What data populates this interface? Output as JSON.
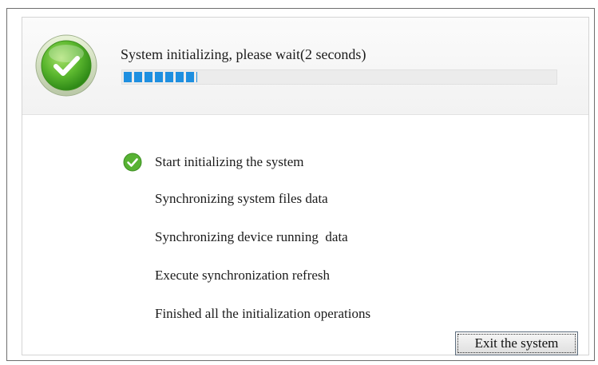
{
  "header": {
    "status_text": "System initializing, please wait(2 seconds)",
    "progress_percent": 17,
    "logo_icon": "green-check-orb-icon"
  },
  "steps": [
    {
      "label": "Start initializing the system",
      "done": true
    },
    {
      "label": "Synchronizing system files data",
      "done": false
    },
    {
      "label": "Synchronizing device running  data",
      "done": false
    },
    {
      "label": "Execute synchronization refresh",
      "done": false
    },
    {
      "label": "Finished all the initialization operations",
      "done": false
    }
  ],
  "footer": {
    "exit_label": "Exit the system"
  },
  "colors": {
    "progress": "#1e8fe0",
    "check_green": "#57b233"
  }
}
